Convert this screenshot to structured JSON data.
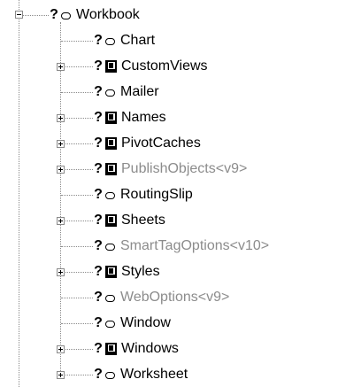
{
  "tree": {
    "root": {
      "label": "Workbook",
      "kind": "object",
      "expanded": true,
      "marker": "?"
    },
    "children": [
      {
        "label": "Chart",
        "kind": "object",
        "expander": false,
        "dim": false,
        "marker": "?"
      },
      {
        "label": "CustomViews",
        "kind": "collection",
        "expander": true,
        "dim": false,
        "marker": "?"
      },
      {
        "label": "Mailer",
        "kind": "object",
        "expander": false,
        "dim": false,
        "marker": "?"
      },
      {
        "label": "Names",
        "kind": "collection",
        "expander": true,
        "dim": false,
        "marker": "?"
      },
      {
        "label": "PivotCaches",
        "kind": "collection",
        "expander": true,
        "dim": false,
        "marker": "?"
      },
      {
        "label": "PublishObjects<v9>",
        "kind": "collection",
        "expander": true,
        "dim": true,
        "marker": "?"
      },
      {
        "label": "RoutingSlip",
        "kind": "object",
        "expander": false,
        "dim": false,
        "marker": "?"
      },
      {
        "label": "Sheets",
        "kind": "collection",
        "expander": true,
        "dim": false,
        "marker": "?"
      },
      {
        "label": "SmartTagOptions<v10>",
        "kind": "object",
        "expander": false,
        "dim": true,
        "marker": "?"
      },
      {
        "label": "Styles",
        "kind": "collection",
        "expander": true,
        "dim": false,
        "marker": "?"
      },
      {
        "label": "WebOptions<v9>",
        "kind": "object",
        "expander": false,
        "dim": true,
        "marker": "?"
      },
      {
        "label": "Window",
        "kind": "object",
        "expander": false,
        "dim": false,
        "marker": "?"
      },
      {
        "label": "Windows",
        "kind": "collection",
        "expander": true,
        "dim": false,
        "marker": "?"
      },
      {
        "label": "Worksheet",
        "kind": "object",
        "expander": true,
        "dim": false,
        "marker": "?"
      }
    ]
  },
  "colors": {
    "text": "#000000",
    "dim_text": "#8c8c8c",
    "connector": "#8a8a8a"
  }
}
